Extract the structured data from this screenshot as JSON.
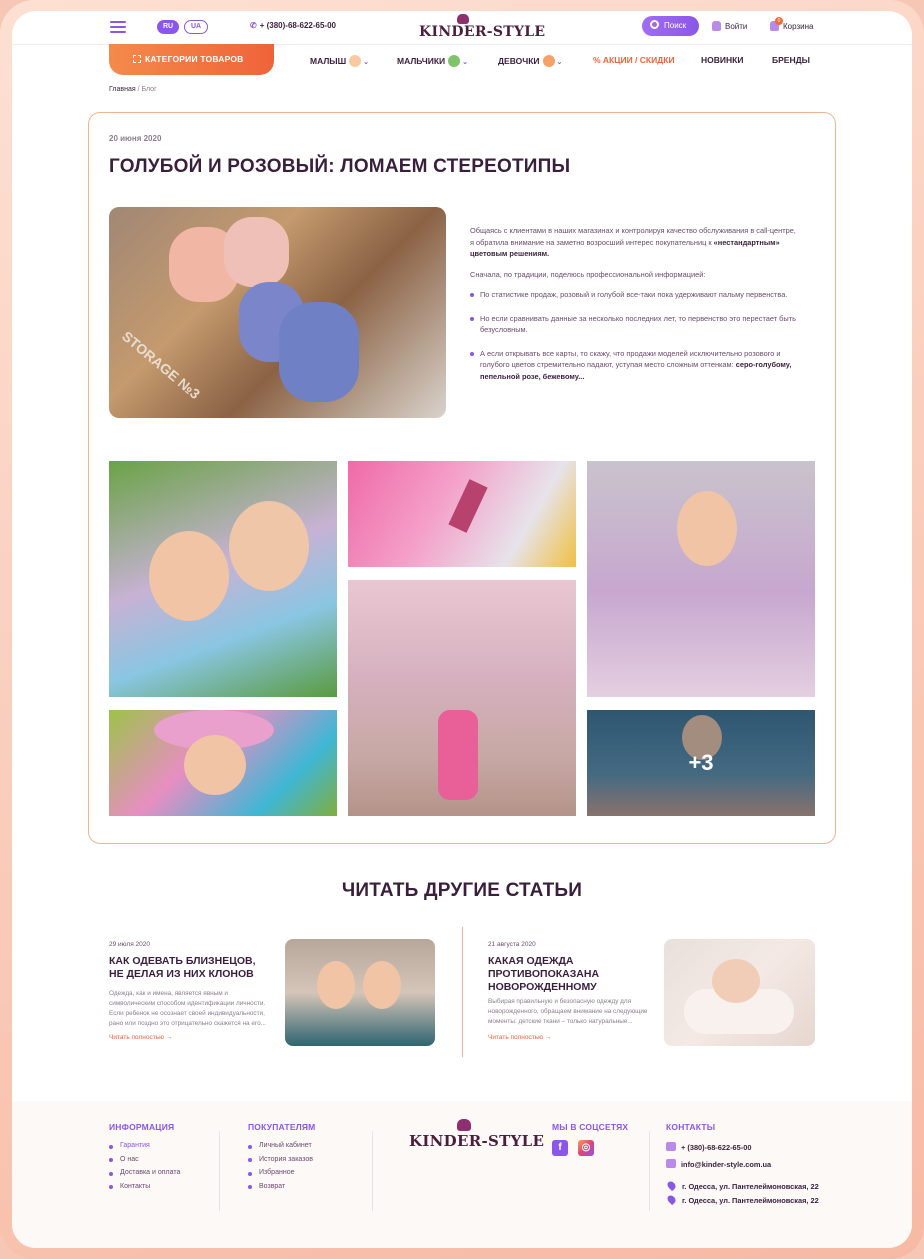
{
  "header": {
    "languages": [
      "RU",
      "UA"
    ],
    "phone": "+ (380)-68-622-65-00",
    "logo": "KINDER-STYLE",
    "search_label": "Поиск",
    "login_label": "Войти",
    "cart_label": "Корзина",
    "cart_count": "0"
  },
  "nav": {
    "categories_button": "КАТЕГОРИИ ТОВАРОВ",
    "items": [
      "МАЛЫШ",
      "МАЛЬЧИКИ",
      "ДЕВОЧКИ",
      "% АКЦИИ / СКИДКИ",
      "НОВИНКИ",
      "БРЕНДЫ"
    ]
  },
  "breadcrumb": {
    "home": "Главная",
    "separator": " / ",
    "current": "Блог"
  },
  "article": {
    "date": "20 июня 2020",
    "title": "ГОЛУБОЙ И РОЗОВЫЙ: ЛОМАЕМ СТЕРЕОТИПЫ",
    "image_text": "STORAGE №3",
    "intro_1": "Общаясь с клиентами в наших магазинах и контролируя качество обслуживания в call-центре, я обратила внимание на заметно возросший интерес покупательниц к ",
    "intro_1_bold": "«нестандартным» цветовым решениям.",
    "intro_2": "Сначала, по традиции, поделюсь профессиональной информацией:",
    "bullets": [
      "По статистике продаж, розовый и голубой все-таки пока удерживают пальму первенства.",
      "Но если сравнивать данные за несколько последних лет, то первенство это перестает быть безусловным.",
      "А если открывать все карты, то скажу, что продажи моделей исключительно розового и голубого цветов стремительно падают, уступая место сложным оттенкам: "
    ],
    "bullet_3_bold": "серо-голубому, пепельной розе, бежевому...",
    "gallery_more": "+3"
  },
  "other": {
    "title": "ЧИТАТЬ ДРУГИЕ СТАТЬИ",
    "articles": [
      {
        "date": "29 июля 2020",
        "title": "КАК ОДЕВАТЬ БЛИЗНЕЦОВ, НЕ ДЕЛАЯ ИЗ НИХ КЛОНОВ",
        "excerpt": "Одежда, как и имена, является явным и символическим способом идентификации личности. Если ребенок не осознает своей индивидуальности, рано или поздно это отрицательно скажется на его...",
        "link": "Читать полностью"
      },
      {
        "date": "21 августа 2020",
        "title": "КАКАЯ ОДЕЖДА ПРОТИВОПОКАЗАНА НОВОРОЖДЕННОМУ",
        "excerpt": "Выбирая правильную и безопасную одежду для новорожденного, обращаем внимание на следующие моменты: детские ткани – только натуральные...",
        "link": "Читать полностью"
      }
    ]
  },
  "footer": {
    "info_title": "ИНФОРМАЦИЯ",
    "info_items": [
      "Гарантия",
      "О нас",
      "Доставка и оплата",
      "Контакты"
    ],
    "buyers_title": "ПОКУПАТЕЛЯМ",
    "buyers_items": [
      "Личный кабинет",
      "История заказов",
      "Избранное",
      "Возврат"
    ],
    "logo": "KINDER-STYLE",
    "social_title": "МЫ В СОЦСЕТЯХ",
    "contacts_title": "КОНТАКТЫ",
    "phone": "+ (380)-68-622-65-00",
    "email": "info@kinder-style.com.ua",
    "addresses": [
      "г. Одесса, ул. Пантелеймоновская, 22",
      "г. Одесса, ул. Пантелеймоновская, 22"
    ]
  },
  "colors": {
    "accent_purple": "#8a57e8",
    "accent_orange": "#f0633a",
    "text_dark": "#3a1f3d"
  }
}
